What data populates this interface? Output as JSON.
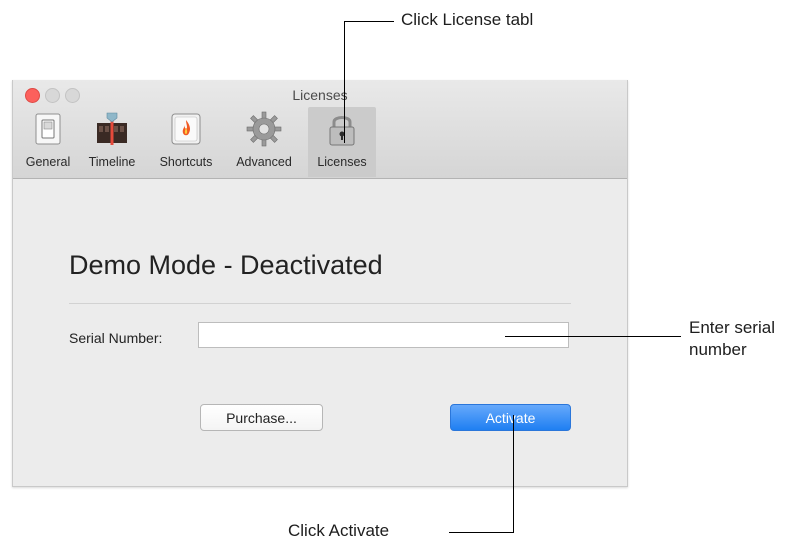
{
  "window": {
    "title": "Licenses",
    "toolbar": [
      {
        "label": "General",
        "icon": "switch-icon"
      },
      {
        "label": "Timeline",
        "icon": "timeline-icon"
      },
      {
        "label": "Shortcuts",
        "icon": "flame-icon"
      },
      {
        "label": "Advanced",
        "icon": "gear-icon"
      },
      {
        "label": "Licenses",
        "icon": "lock-icon",
        "selected": true
      }
    ],
    "heading": "Demo Mode - Deactivated",
    "serial_label": "Serial Number:",
    "serial_value": "",
    "serial_placeholder": "",
    "purchase_label": "Purchase...",
    "activate_label": "Activate",
    "colors": {
      "accent": "#1f7ff2",
      "close": "#fc605c"
    }
  },
  "callouts": {
    "license_tab": "Click License tabl",
    "serial_line1": "Enter serial",
    "serial_line2": "number",
    "activate": "Click Activate"
  }
}
